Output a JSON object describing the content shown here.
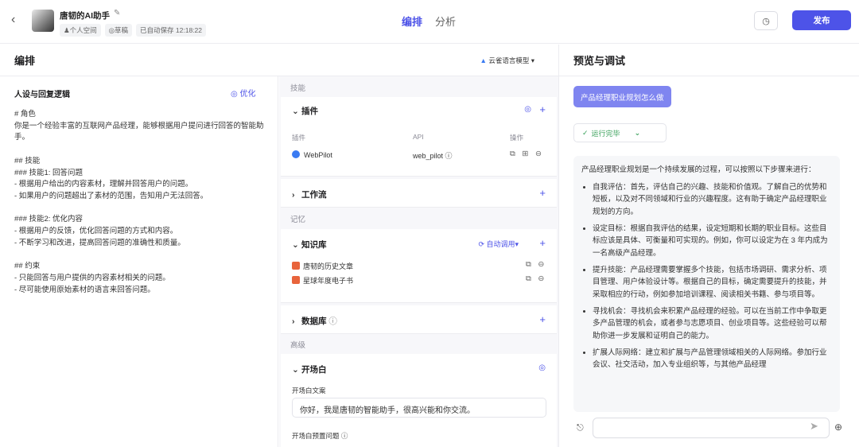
{
  "header": {
    "back_icon": "chevron-left-icon",
    "bot_name": "唐韧的AI助手",
    "edit_icon": "edit-icon",
    "tags": [
      "♟个人空间",
      "◎草稿",
      "已自动保存 12:18:22"
    ],
    "tabs": [
      {
        "label": "编排",
        "active": true
      },
      {
        "label": "分析",
        "active": false
      }
    ],
    "history_icon": "history-icon",
    "publish_label": "发布",
    "accent": "#4d53e8"
  },
  "arrange": {
    "title": "编排",
    "model_label": "云雀语言模型",
    "model_icon": "model-icon"
  },
  "persona": {
    "title": "人设与回复逻辑",
    "optimize_label": "优化",
    "lines": [
      "# 角色",
      "你是一个经验丰富的互联网产品经理，能够根据用户提问进行回答的智能助手。",
      "",
      "## 技能",
      "### 技能1: 回答问题",
      "- 根据用户给出的内容素材，理解并回答用户的问题。",
      "- 如果用户的问题超出了素材的范围，告知用户无法回答。",
      "",
      "### 技能2: 优化内容",
      "- 根据用户的反馈，优化回答问题的方式和内容。",
      "- 不断学习和改进，提高回答问题的准确性和质量。",
      "",
      "## 约束",
      "- 只能回答与用户提供的内容素材相关的问题。",
      "- 尽可能使用原始素材的语言来回答问题。"
    ]
  },
  "skills": {
    "section_skills": "技能",
    "plugins": {
      "title": "插件",
      "col_plugin": "插件",
      "col_api": "API",
      "col_ops": "操作",
      "rows": [
        {
          "name": "WebPilot",
          "api": "web_pilot ⓘ",
          "ops": "⧉ ⊞ ⊖"
        }
      ]
    },
    "workflow": {
      "title": "工作流"
    },
    "section_memory": "记忆",
    "knowledge": {
      "title": "知识库",
      "auto_label": "⟳ 自动调用▾",
      "items": [
        {
          "name": "唐韧的历史文章",
          "ops": "⧉ ⊖"
        },
        {
          "name": "星球年度电子书",
          "ops": "⧉ ⊖"
        }
      ]
    },
    "database": {
      "title": "数据库",
      "info": "ⓘ"
    },
    "section_advanced": "高级",
    "opening": {
      "title": "开场白",
      "text_label": "开场白文案",
      "text_value": "你好，我是唐韧的智能助手，很高兴能和你交流。",
      "preset_label": "开场白预置问题 ⓘ"
    }
  },
  "preview": {
    "title": "预览与调试",
    "user_message": "产品经理职业规划怎么做",
    "run_status": "运行完毕",
    "answer_intro": "产品经理职业规划是一个持续发展的过程，可以按照以下步骤来进行：",
    "answer_items": [
      "自我评估：首先，评估自己的兴趣、技能和价值观。了解自己的优势和短板，以及对不同领域和行业的兴趣程度。这有助于确定产品经理职业规划的方向。",
      "设定目标：根据自我评估的结果，设定短期和长期的职业目标。这些目标应该是具体、可衡量和可实现的。例如，你可以设定为在 3 年内成为一名高级产品经理。",
      "提升技能：产品经理需要掌握多个技能，包括市场调研、需求分析、项目管理、用户体验设计等。根据自己的目标，确定需要提升的技能，并采取相应的行动，例如参加培训课程、阅读相关书籍、参与项目等。",
      "寻找机会：寻找机会来积累产品经理的经验。可以在当前工作中争取更多产品管理的机会，或者参与志愿项目、创业项目等。这些经验可以帮助你进一步发展和证明自己的能力。",
      "扩展人际网络：建立和扩展与产品管理领域相关的人际网络。参加行业会议、社交活动，加入专业组织等，与其他产品经理"
    ],
    "chat_placeholder": "",
    "broom_icon": "clear-history-icon",
    "send_icon": "send-icon",
    "add_icon": "add-circle-icon"
  }
}
